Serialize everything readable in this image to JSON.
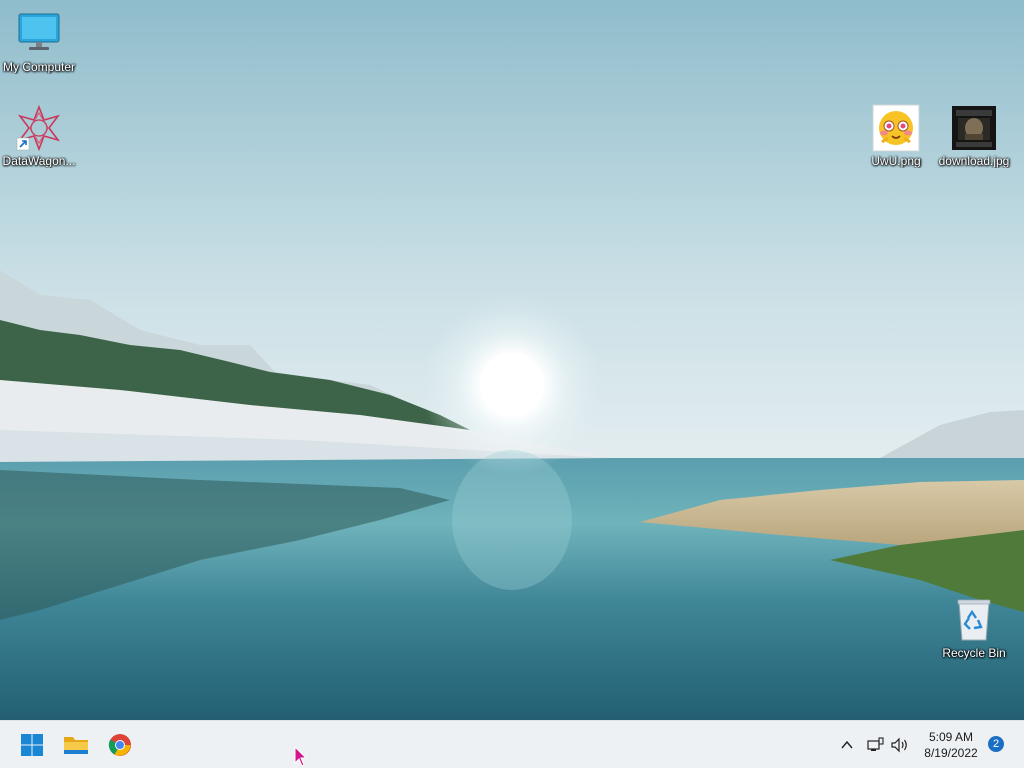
{
  "desktop": {
    "icons": [
      {
        "label": "My Computer",
        "icon": "monitor-icon"
      },
      {
        "label": "DataWagon...",
        "icon": "datawagon-shortcut-icon"
      },
      {
        "label": "UwU.png",
        "icon": "emoji-image-icon"
      },
      {
        "label": "download.jpg",
        "icon": "photo-thumbnail-icon"
      },
      {
        "label": "Recycle Bin",
        "icon": "recycle-bin-icon"
      }
    ]
  },
  "taskbar": {
    "pinned": [
      {
        "name": "Start",
        "icon": "windows-start-icon"
      },
      {
        "name": "File Explorer",
        "icon": "folder-icon"
      },
      {
        "name": "Google Chrome",
        "icon": "chrome-icon"
      }
    ],
    "tray": {
      "overflow_icon": "chevron-up-icon",
      "network_icon": "network-icon",
      "volume_icon": "speaker-icon"
    },
    "clock": {
      "time": "5:09 AM",
      "date": "8/19/2022"
    },
    "notifications": {
      "count": "2"
    }
  },
  "colors": {
    "taskbar_bg": "#eef1f4",
    "accent": "#1a6fc4"
  }
}
